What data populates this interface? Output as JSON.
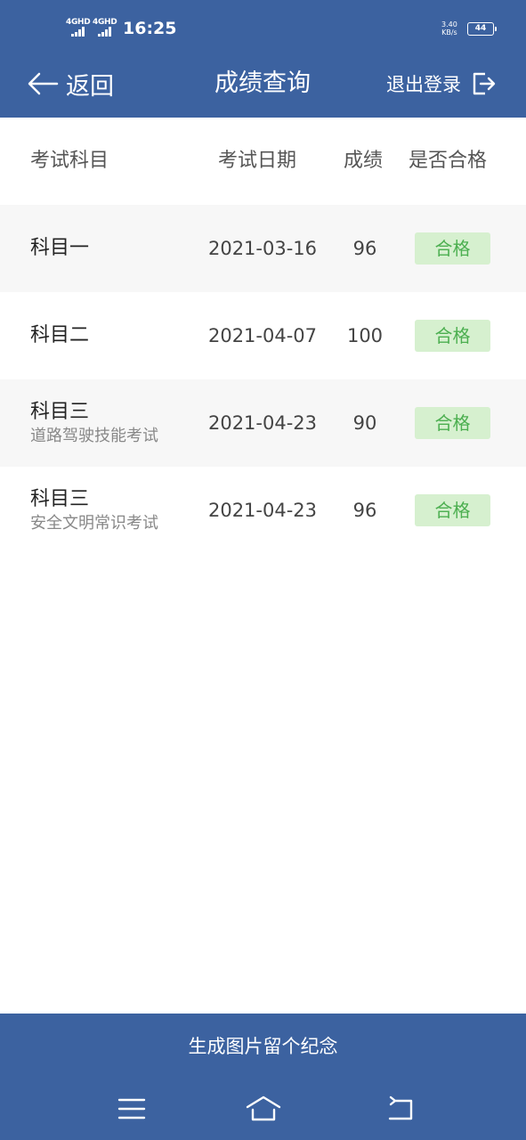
{
  "status_bar": {
    "signal1": "4GHD",
    "signal2": "4GHD",
    "time": "16:25",
    "speed_value": "3.40",
    "speed_unit": "KB/s",
    "battery": "44"
  },
  "header": {
    "back_label": "返回",
    "title": "成绩查询",
    "logout_label": "退出登录",
    "back_icon": "arrow-left-icon",
    "logout_icon": "logout-icon"
  },
  "table": {
    "columns": [
      "考试科目",
      "考试日期",
      "成绩",
      "是否合格"
    ],
    "rows": [
      {
        "subject": "科目一",
        "subtitle": "",
        "date": "2021-03-16",
        "score": "96",
        "result": "合格"
      },
      {
        "subject": "科目二",
        "subtitle": "",
        "date": "2021-04-07",
        "score": "100",
        "result": "合格"
      },
      {
        "subject": "科目三",
        "subtitle": "道路驾驶技能考试",
        "date": "2021-04-23",
        "score": "90",
        "result": "合格"
      },
      {
        "subject": "科目三",
        "subtitle": "安全文明常识考试",
        "date": "2021-04-23",
        "score": "96",
        "result": "合格"
      }
    ]
  },
  "footer": {
    "generate_label": "生成图片留个纪念"
  },
  "system_nav": {
    "menu_icon": "menu-icon",
    "home_icon": "home-icon",
    "back_icon": "back-icon"
  },
  "colors": {
    "primary": "#3c62a0",
    "pass_bg": "#d6f0cf",
    "pass_text": "#4caf50"
  }
}
